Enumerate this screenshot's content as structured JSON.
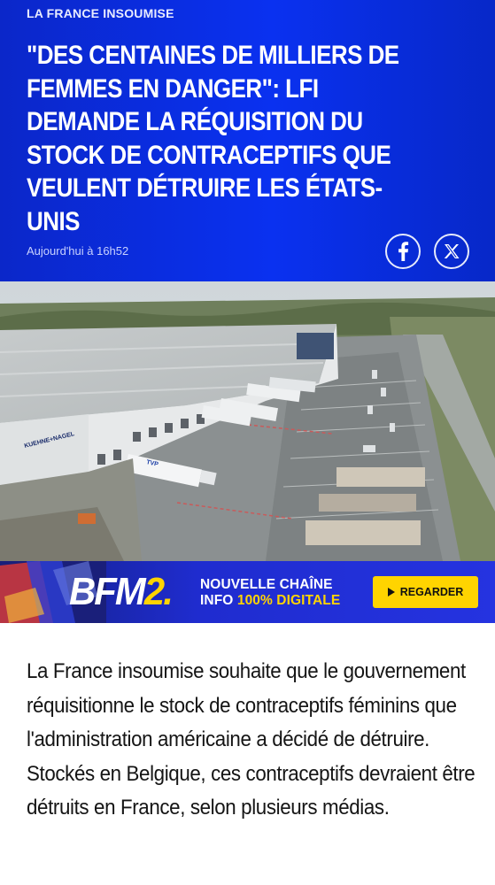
{
  "article": {
    "category": "LA FRANCE INSOUMISE",
    "title": "\"DES CENTAINES DE MILLIERS DE FEMMES EN DANGER\": LFI DEMANDE LA RÉQUISITION DU STOCK DE CONTRACEPTIFS QUE VEULENT DÉTRUIRE LES ÉTATS-UNIS",
    "timestamp": "Aujourd'hui à 16h52",
    "body": "La France insoumise souhaite que le gouvernement réquisitionne le stock de contraceptifs féminins que l'administration américaine a décidé de détruire. Stockés en Belgique, ces contraceptifs devraient être détruits en France, selon plusieurs médias."
  },
  "share": {
    "facebook_icon": "facebook-icon",
    "x_icon": "x-icon"
  },
  "photo": {
    "icon": "info-icon",
    "building_sign": "KUEHNE+NAGEL",
    "truck_label": "TVP"
  },
  "banner": {
    "logo_main": "BFM",
    "logo_accent": "2.",
    "line1": "NOUVELLE CHAÎNE",
    "line2_prefix": "INFO ",
    "line2_accent": "100% DIGITALE",
    "cta_icon": "play-icon",
    "cta_label": "REGARDER"
  },
  "colors": {
    "brand_blue": "#0a31f0",
    "accent_yellow": "#ffd400"
  }
}
